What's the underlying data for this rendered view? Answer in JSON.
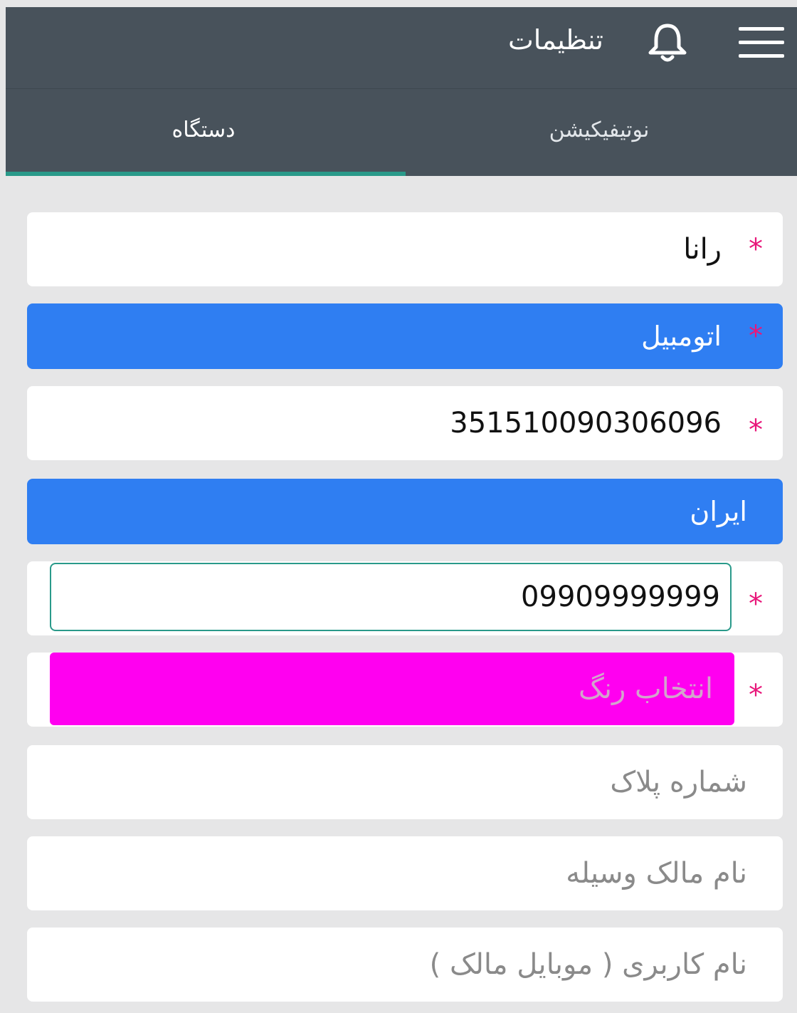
{
  "appbar": {
    "title": "تنظیمات"
  },
  "tabs": [
    {
      "label": "نوتیفیکیشن",
      "active": false
    },
    {
      "label": "دستگاه",
      "active": true
    }
  ],
  "form": {
    "name": {
      "value": "رانا",
      "required": true
    },
    "vehicle_type": {
      "value": "اتومبیل",
      "required": true
    },
    "device_id": {
      "value": "351510090306096",
      "required": true
    },
    "country": {
      "value": "ایران",
      "required": false
    },
    "phone": {
      "value": "09909999999",
      "required": true
    },
    "color": {
      "placeholder": "انتخاب رنگ",
      "required": true,
      "color": "#ff00f0"
    },
    "plate_number": {
      "placeholder": "شماره پلاک"
    },
    "owner_name": {
      "placeholder": "نام مالک وسیله"
    },
    "username": {
      "placeholder": "نام کاربری ( موبایل مالک )"
    }
  },
  "icons": {
    "menu": "menu-icon",
    "notifications": "bell-icon",
    "dropdown": "caret-down-icon"
  },
  "colors": {
    "appbar": "#48525b",
    "tab_indicator": "#2a9a8a",
    "select_bg": "#2f7ef2",
    "required_marker": "#e8177a",
    "background": "#e6e6e7"
  }
}
